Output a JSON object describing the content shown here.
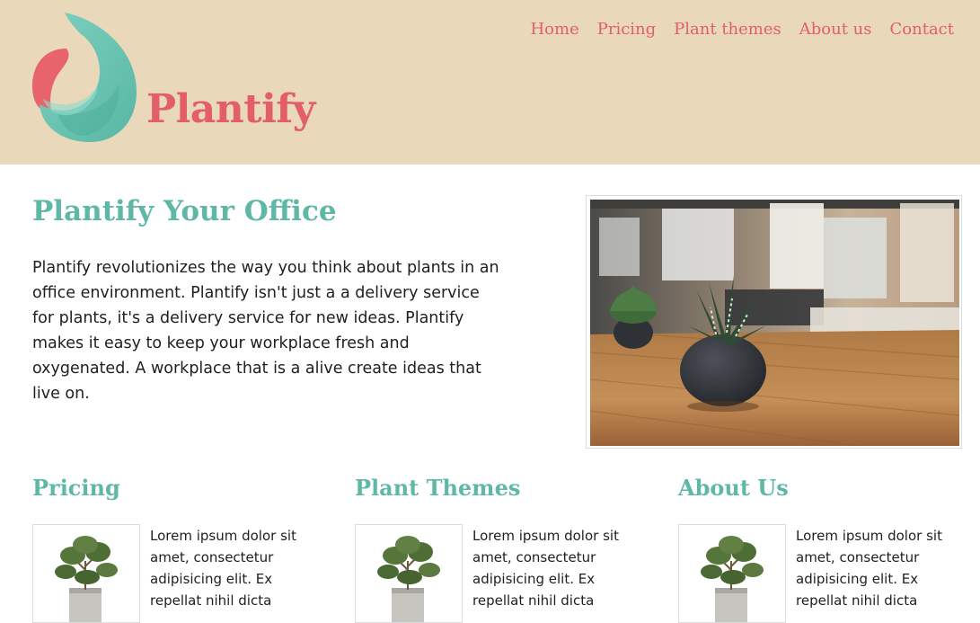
{
  "brand": {
    "name": "Plantify",
    "logo_icon": "droplet-leaf-logo-icon"
  },
  "colors": {
    "header_bg": "#e9d8ba",
    "brand_red": "#e25f69",
    "teal": "#5fb8a6"
  },
  "nav": {
    "items": [
      {
        "label": "Home"
      },
      {
        "label": "Pricing"
      },
      {
        "label": "Plant themes"
      },
      {
        "label": "About us"
      },
      {
        "label": "Contact"
      }
    ]
  },
  "hero": {
    "title": "Plantify Your Office",
    "text": "Plantify revolutionizes the way you think about plants in an office environment. Plantify isn't just a a delivery service for plants, it's a delivery service for new ideas. Plantify makes it easy to keep your workplace fresh and oxygenated. A workplace that is a alive create ideas that live on.",
    "image": "office-desk-plant-photo"
  },
  "columns": [
    {
      "title": "Pricing",
      "text": "Lorem ipsum dolor sit amet, consectetur adipisicing elit. Ex repellat nihil dicta",
      "image": "potted-plant-thumbnail"
    },
    {
      "title": "Plant Themes",
      "text": "Lorem ipsum dolor sit amet, consectetur adipisicing elit. Ex repellat nihil dicta",
      "image": "potted-plant-thumbnail"
    },
    {
      "title": "About Us",
      "text": "Lorem ipsum dolor sit amet, consectetur adipisicing elit. Ex repellat nihil dicta",
      "image": "potted-plant-thumbnail"
    }
  ]
}
